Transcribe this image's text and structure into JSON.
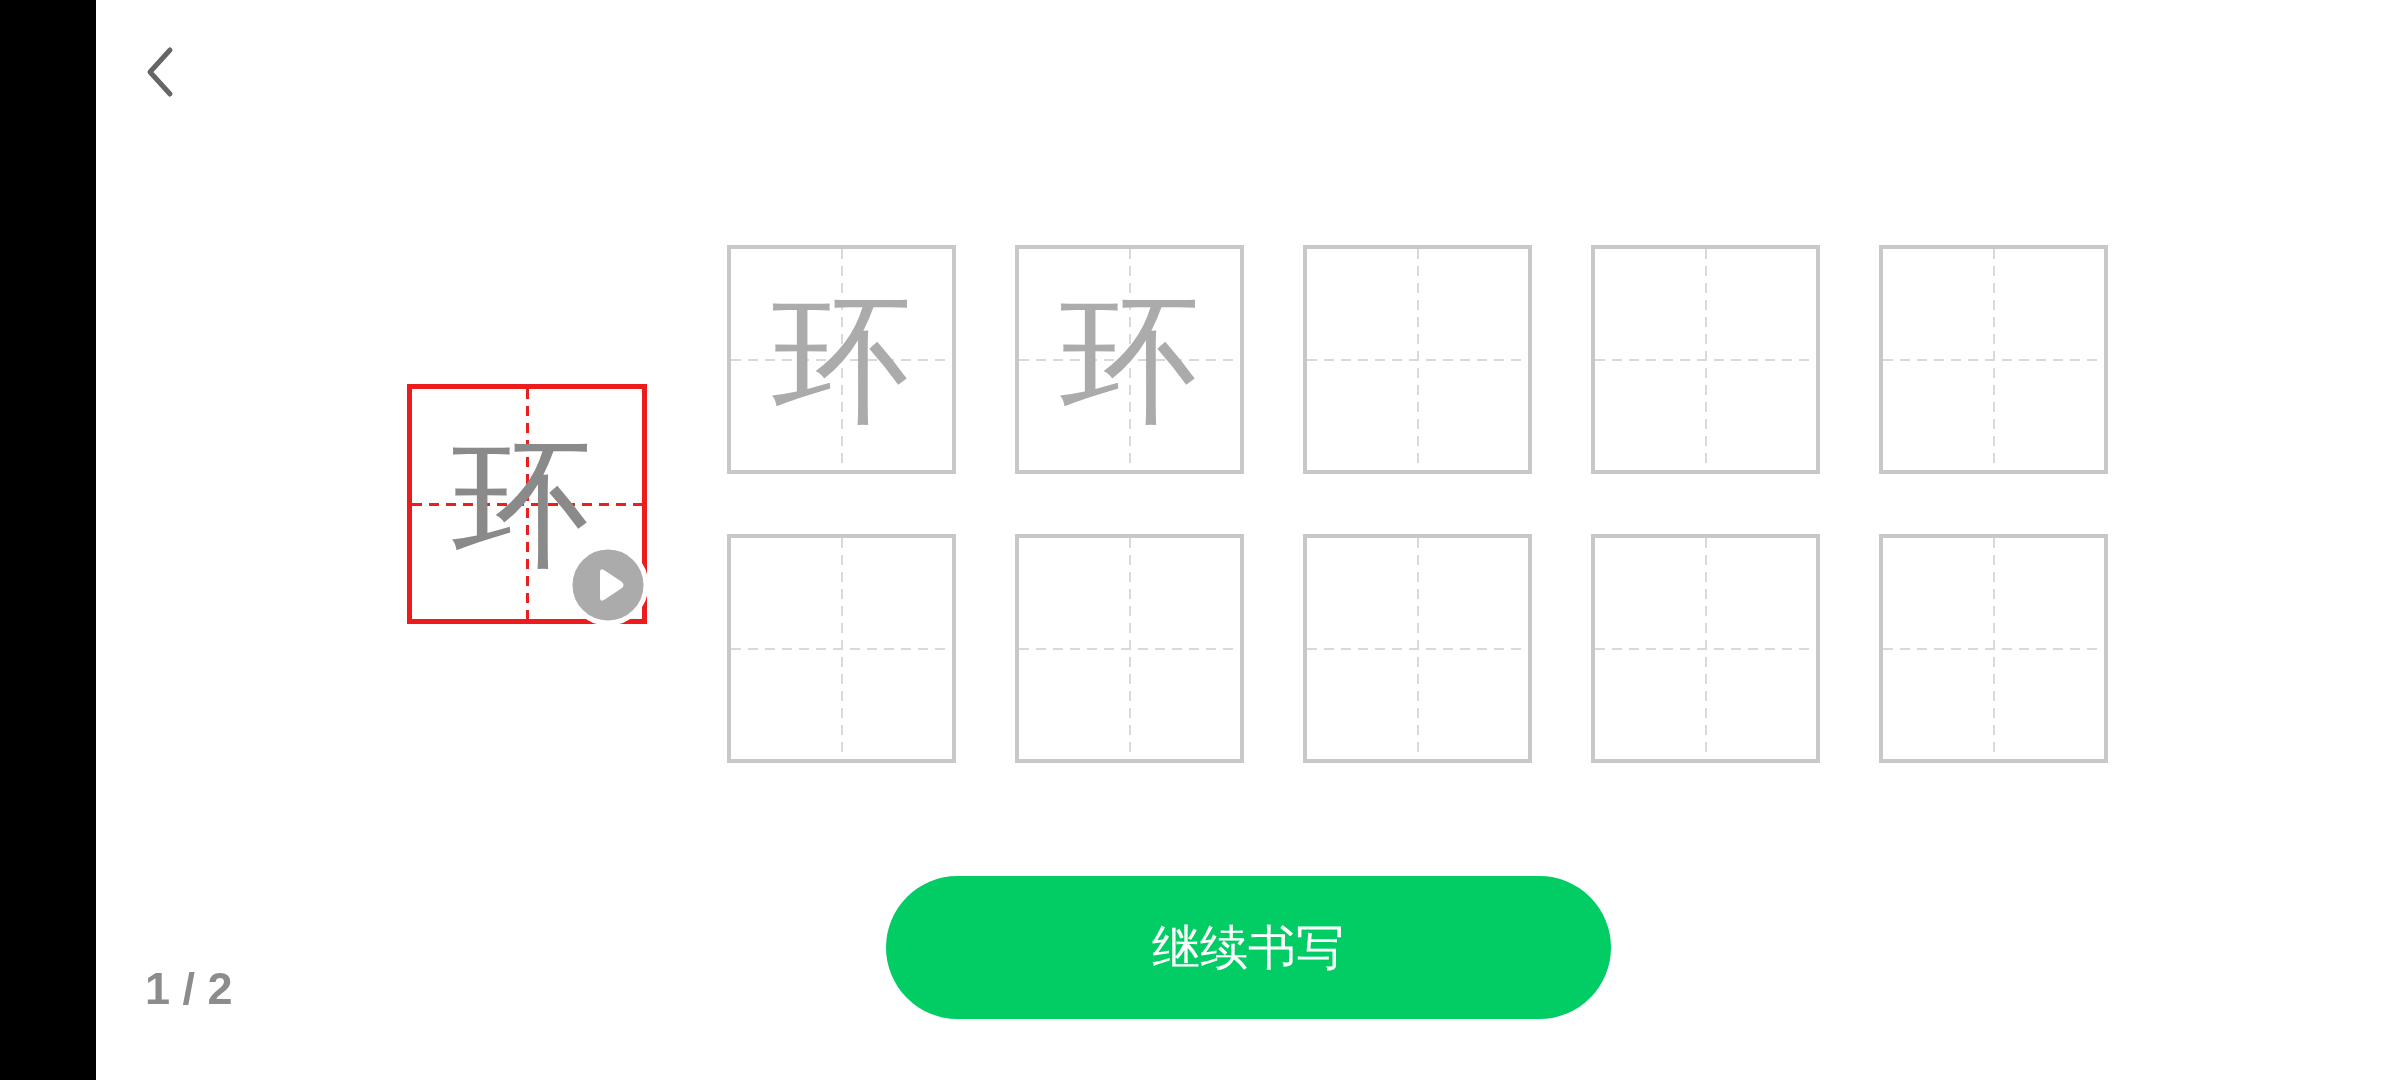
{
  "model": {
    "character": "环"
  },
  "practice_grid": {
    "cells": [
      {
        "kind": "traced",
        "character": "环"
      },
      {
        "kind": "traced",
        "character": "环"
      },
      {
        "kind": "blank"
      },
      {
        "kind": "blank"
      },
      {
        "kind": "blank"
      },
      {
        "kind": "blank"
      },
      {
        "kind": "blank"
      },
      {
        "kind": "blank"
      },
      {
        "kind": "blank"
      },
      {
        "kind": "blank"
      }
    ]
  },
  "action_button": {
    "label": "继续书写"
  },
  "page_indicator": "1 / 2"
}
